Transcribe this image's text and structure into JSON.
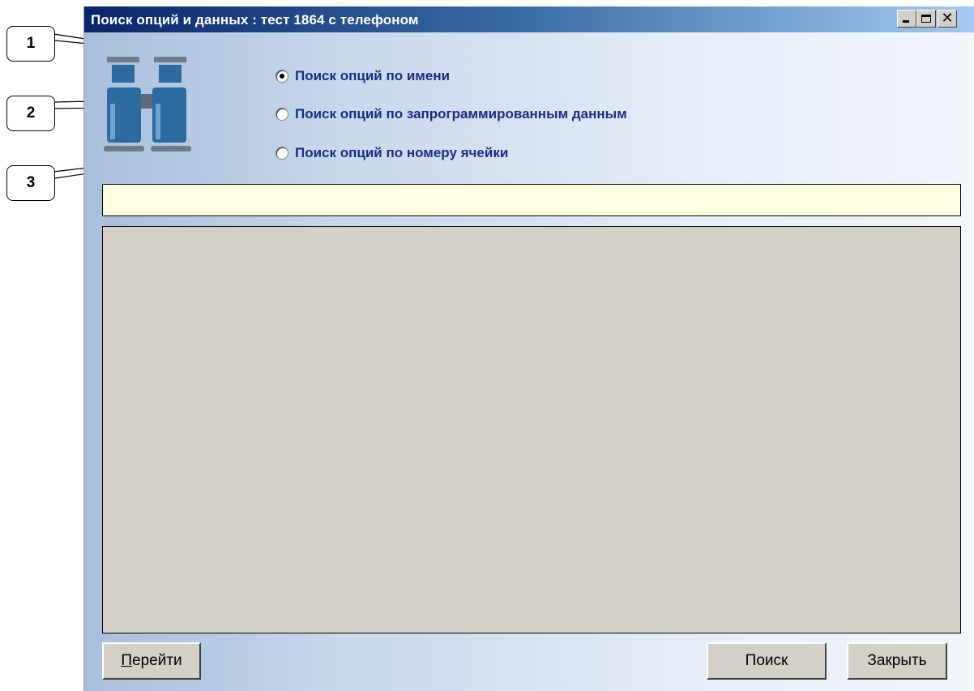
{
  "window": {
    "title": "Поиск опций и данных : тест 1864 с телефоном",
    "controls": {
      "minimize_icon": "minimize-icon",
      "maximize_icon": "maximize-icon",
      "close_icon": "close-icon",
      "close_glyph": "✕"
    }
  },
  "search_mode": {
    "options": [
      {
        "label": "Поиск опций по имени",
        "selected": true
      },
      {
        "label": "Поиск опций по запрограммированным данным",
        "selected": false
      },
      {
        "label": "Поиск опций по номеру ячейки",
        "selected": false
      }
    ]
  },
  "search": {
    "value": "",
    "placeholder": ""
  },
  "results": {
    "items": []
  },
  "buttons": {
    "goto_mnemonic": "П",
    "goto_rest": "ерейти",
    "search": "Поиск",
    "close": "Закрыть"
  },
  "callouts": [
    "1",
    "2",
    "3"
  ],
  "colors": {
    "title_bar_start": "#0a246a",
    "option_text": "#1c2c86",
    "input_background": "#ffffe1",
    "panel_background": "#d4d0c8"
  }
}
